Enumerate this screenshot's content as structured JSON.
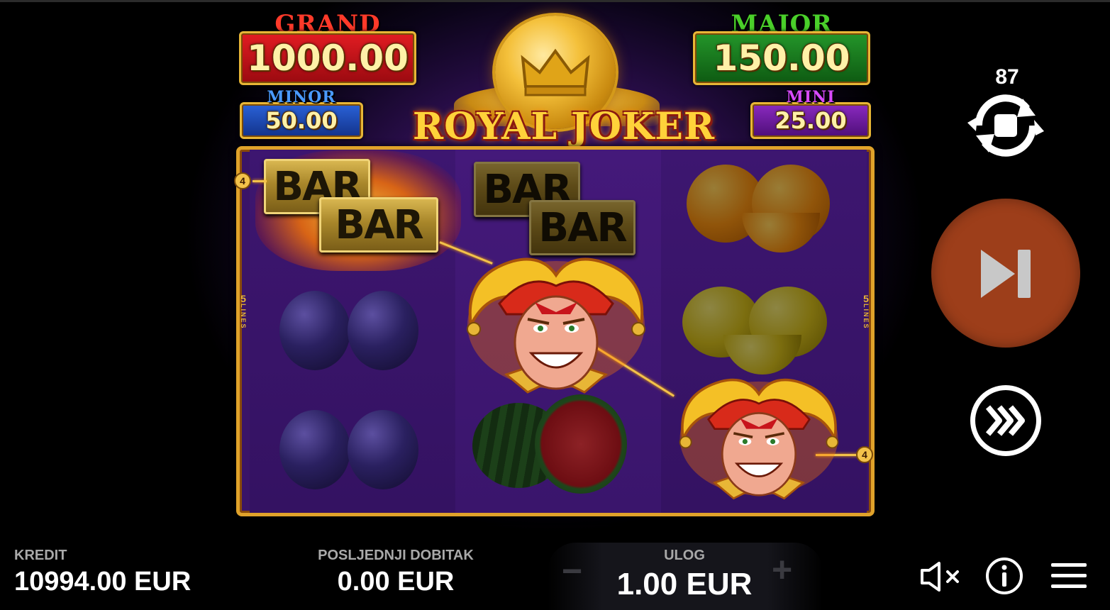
{
  "jackpots": {
    "grand": {
      "label": "GRAND",
      "value": "1000.00"
    },
    "major": {
      "label": "MAJOR",
      "value": "150.00"
    },
    "minor": {
      "label": "MINOR",
      "value": "50.00"
    },
    "mini": {
      "label": "MINI",
      "value": "25.00"
    }
  },
  "game": {
    "title": "ROYAL JOKER"
  },
  "reels": {
    "lines_label": "LINES",
    "lines_count": "5",
    "line_badge_left": "4",
    "line_badge_right": "4",
    "symbol_bar": "BAR"
  },
  "controls": {
    "autospin_count": "87",
    "icons": [
      "autospin-stop-icon",
      "spin-skip-icon",
      "turbo-icon",
      "mute-icon",
      "info-icon",
      "menu-icon"
    ]
  },
  "footer": {
    "credit_label": "KREDIT",
    "credit_value": "10994.00 EUR",
    "last_win_label": "POSLJEDNJI DOBITAK",
    "last_win_value": "0.00 EUR",
    "bet_label": "ULOG",
    "bet_value": "1.00 EUR",
    "bet_minus": "−",
    "bet_plus": "+"
  },
  "colors": {
    "grand": "#c8141c",
    "major": "#1a7a1a",
    "minor": "#1f4fbf",
    "mini": "#7a1fa8",
    "spin_button": "#9d3e1a",
    "gold": "#e8b636"
  }
}
